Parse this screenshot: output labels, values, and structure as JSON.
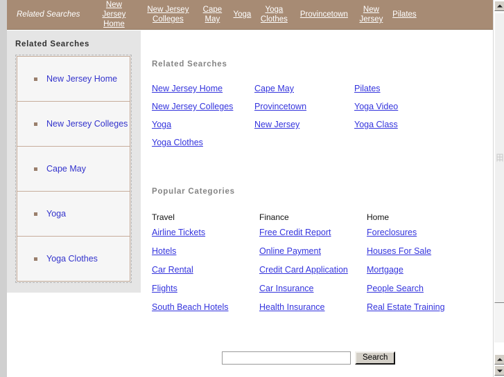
{
  "topbar": {
    "label": "Related Searches",
    "links": [
      "New Jersey Home",
      "New Jersey Colleges",
      "Cape May",
      "Yoga",
      "Yoga Clothes",
      "Provincetown",
      "New Jersey",
      "Pilates"
    ]
  },
  "sidebar": {
    "heading": "Related Searches",
    "items": [
      "New Jersey Home",
      "New Jersey Colleges",
      "Cape May",
      "Yoga",
      "Yoga Clothes"
    ]
  },
  "main": {
    "related_searches": {
      "heading": "Related Searches",
      "links": [
        "New Jersey Home",
        "Cape May",
        "Pilates",
        "New Jersey Colleges",
        "Provincetown",
        "Yoga Video",
        "Yoga",
        "New Jersey",
        "Yoga Class",
        "Yoga Clothes"
      ]
    },
    "popular_categories": {
      "heading": "Popular Categories",
      "columns": [
        {
          "title": "Travel",
          "links": [
            "Airline Tickets",
            "Hotels",
            "Car Rental",
            "Flights",
            "South Beach Hotels"
          ]
        },
        {
          "title": "Finance",
          "links": [
            "Free Credit Report",
            "Online Payment",
            "Credit Card Application",
            "Car Insurance",
            "Health Insurance"
          ]
        },
        {
          "title": "Home",
          "links": [
            "Foreclosures",
            "Houses For Sale",
            "Mortgage",
            "People Search",
            "Real Estate Training"
          ]
        }
      ]
    }
  },
  "search": {
    "value": "",
    "placeholder": "",
    "button_label": "Search"
  },
  "colors": {
    "topbar_brown": "#a78b74",
    "sidebar_grey": "#e5e5e5",
    "item_border": "#c6ac9a",
    "link_blue": "#3333dd",
    "heading_grey": "#848484",
    "bullet_brown": "#9a7f6c"
  }
}
